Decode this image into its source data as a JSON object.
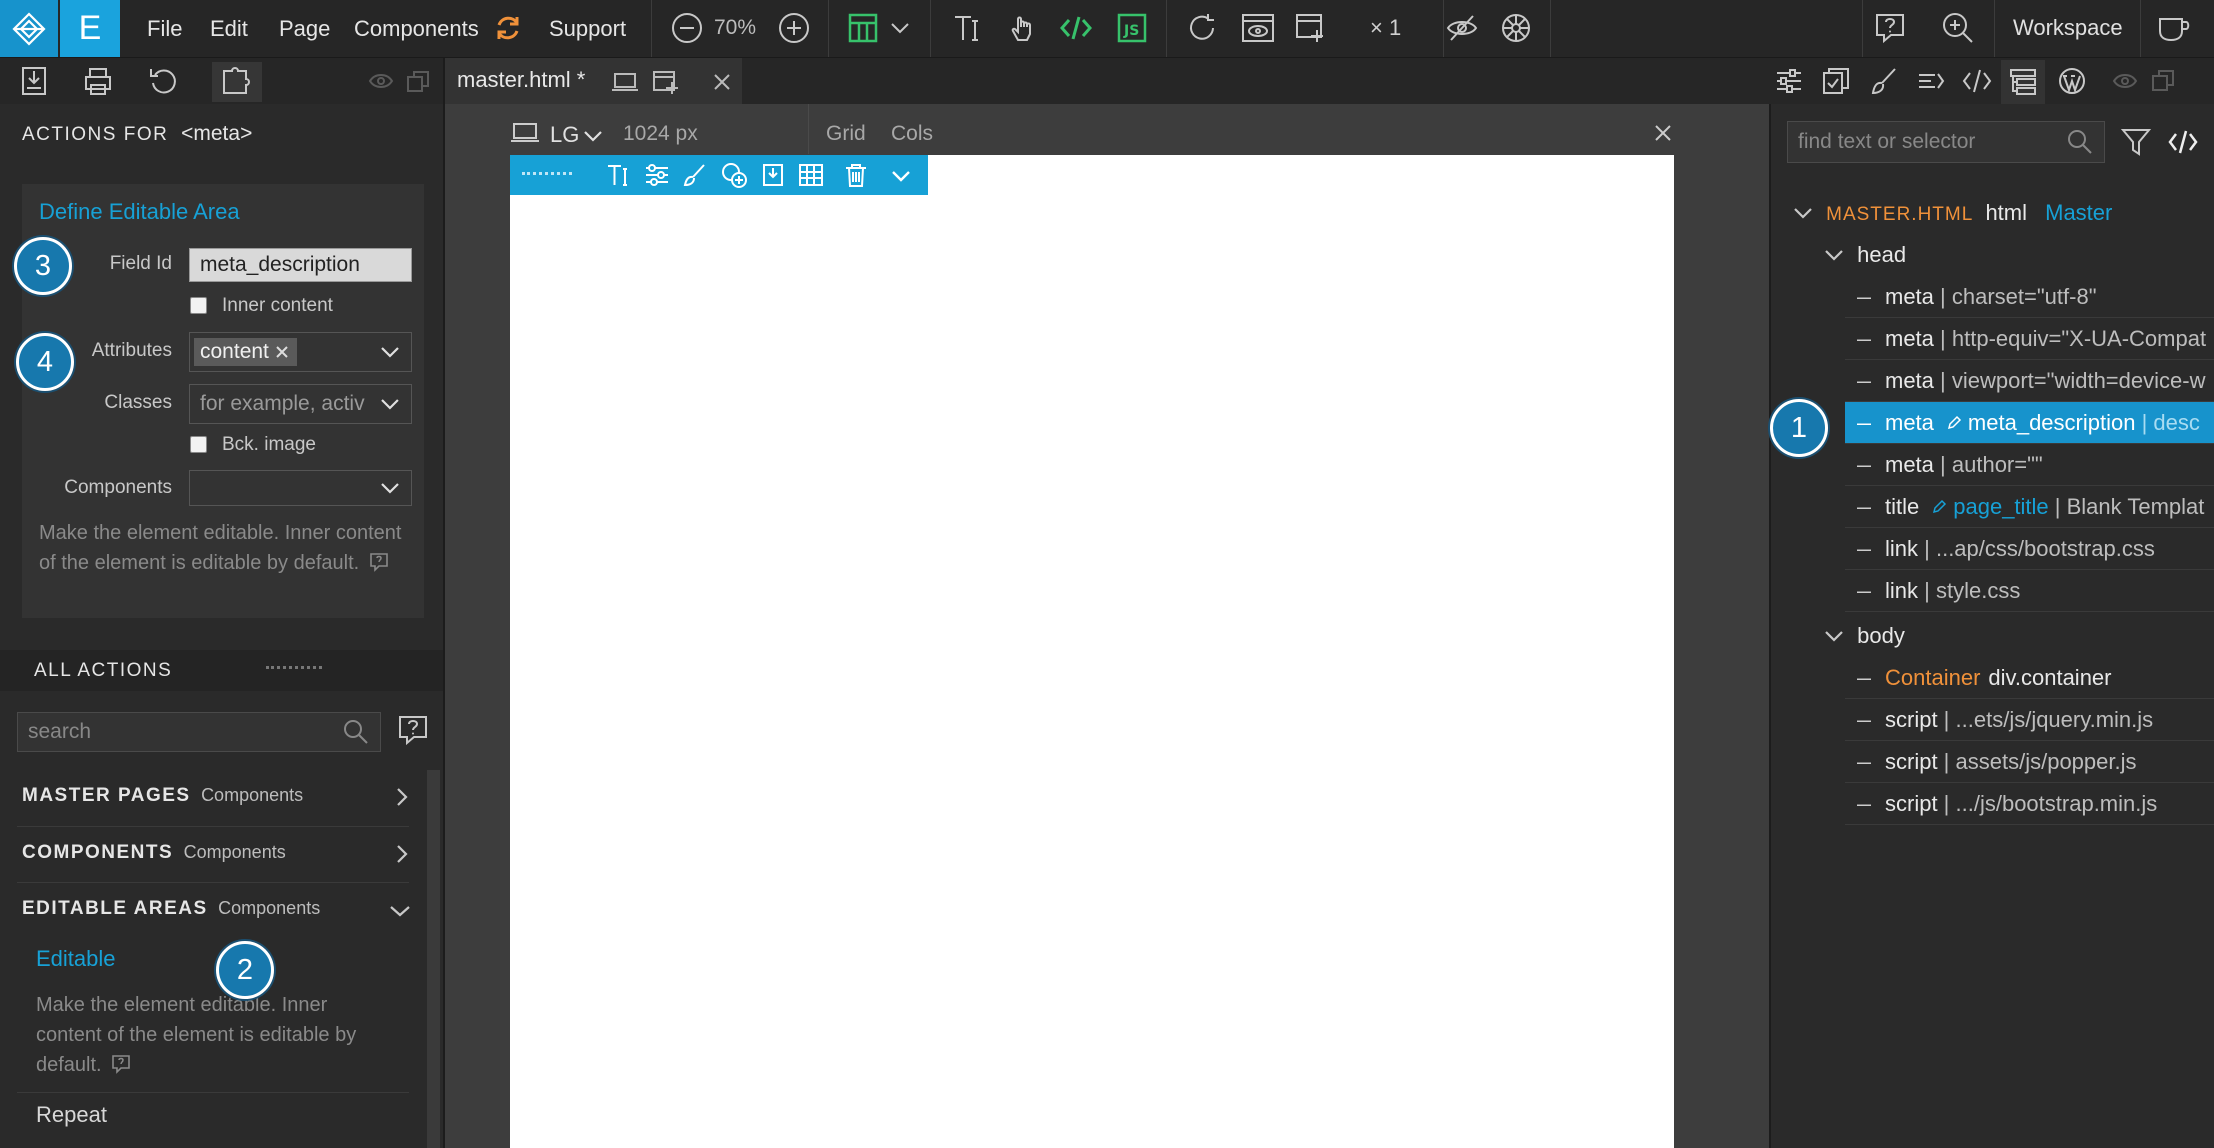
{
  "menu": {
    "logo_letter": "E",
    "items": [
      "File",
      "Edit",
      "Page",
      "Components",
      "Support"
    ]
  },
  "toolbar": {
    "zoom": "70%",
    "multiplier": "× 1",
    "workspace": "Workspace"
  },
  "tab": {
    "title": "master.html *"
  },
  "canvas": {
    "device": "LG",
    "width": "1024 px",
    "grid": "Grid",
    "cols": "Cols"
  },
  "actions": {
    "header_prefix": "ACTIONS FOR",
    "header_tag": "<meta>",
    "title": "Define Editable Area",
    "field_id_label": "Field Id",
    "field_id_value": "meta_description",
    "inner_content_label": "Inner content",
    "attributes_label": "Attributes",
    "attributes_tag": "content",
    "classes_label": "Classes",
    "classes_placeholder": "for example, activ",
    "bck_image_label": "Bck. image",
    "components_label": "Components",
    "description": "Make the element editable. Inner content of the element is editable by default."
  },
  "all_actions": {
    "title": "ALL ACTIONS",
    "search_placeholder": "search",
    "sections": [
      {
        "name": "MASTER PAGES",
        "sub": "Components"
      },
      {
        "name": "COMPONENTS",
        "sub": "Components"
      },
      {
        "name": "EDITABLE AREAS",
        "sub": "Components"
      }
    ],
    "editable_item": "Editable",
    "editable_desc": "Make the element editable. Inner content of the element is editable by default.",
    "repeat_item": "Repeat"
  },
  "tree": {
    "search_placeholder": "find text or selector",
    "root_file": "MASTER.HTML",
    "root_tag": "html",
    "root_master": "Master",
    "head": "head",
    "body": "body",
    "rows": [
      {
        "tag": "meta",
        "sep": " | ",
        "rest": "charset=\"utf-8\""
      },
      {
        "tag": "meta",
        "sep": " | ",
        "rest": "http-equiv=\"X-UA-Compat"
      },
      {
        "tag": "meta",
        "sep": " | ",
        "rest": "viewport=\"width=device-w"
      },
      {
        "tag": "meta",
        "field": "meta_description",
        "sep": " | ",
        "rest": "desc"
      },
      {
        "tag": "meta",
        "sep": " | ",
        "rest": "author=\"\""
      },
      {
        "tag": "title",
        "field": "page_title",
        "sep": " | ",
        "rest": "Blank Templat"
      },
      {
        "tag": "link",
        "sep": " | ",
        "rest": "...ap/css/bootstrap.css"
      },
      {
        "tag": "link",
        "sep": " | ",
        "rest": "style.css"
      }
    ],
    "body_rows": [
      {
        "comp": "Container",
        "tag": "div.container"
      },
      {
        "tag": "script",
        "sep": " | ",
        "rest": "...ets/js/jquery.min.js"
      },
      {
        "tag": "script",
        "sep": " | ",
        "rest": "assets/js/popper.js"
      },
      {
        "tag": "script",
        "sep": " | ",
        "rest": ".../js/bootstrap.min.js"
      }
    ]
  },
  "badges": [
    "1",
    "2",
    "3",
    "4"
  ],
  "colors": {
    "accent": "#17a1d6",
    "orange": "#f0913a",
    "green": "#37c26b",
    "badge": "#1778ad"
  }
}
